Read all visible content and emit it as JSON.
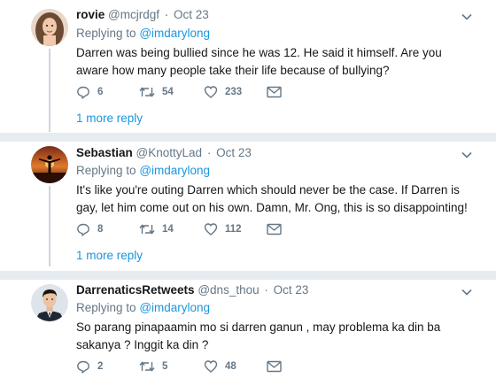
{
  "tweets": [
    {
      "name": "rovie",
      "handle": "@mcjrdgf",
      "time": "Oct 23",
      "replying_prefix": "Replying to",
      "replying_mention": "@imdarylong",
      "text": "Darren was being bullied since he was 12.  He said it himself.  Are you aware how many people take their life because of bullying?",
      "replies": "6",
      "retweets": "54",
      "likes": "233",
      "more_replies": "1 more reply",
      "avatar_icon": "woman-portrait"
    },
    {
      "name": "Sebastian",
      "handle": "@KnottyLad",
      "time": "Oct 23",
      "replying_prefix": "Replying to",
      "replying_mention": "@imdarylong",
      "text": "It's like you're outing Darren which should never be the case. If Darren is gay, let him come out on his own. Damn, Mr. Ong, this is so disappointing!",
      "replies": "8",
      "retweets": "14",
      "likes": "112",
      "more_replies": "1 more reply",
      "avatar_icon": "sunset-silhouette"
    },
    {
      "name": "DarrenaticsRetweets",
      "handle": "@dns_thou",
      "time": "Oct 23",
      "replying_prefix": "Replying to",
      "replying_mention": "@imdarylong",
      "text": "So parang pinapaamin mo si darren ganun , may problema ka din ba sakanya ? Inggit ka din ?",
      "replies": "2",
      "retweets": "5",
      "likes": "48",
      "avatar_icon": "man-in-suit"
    }
  ],
  "colors": {
    "link": "#1b95e0",
    "secondary_text": "#657786",
    "separator": "#e6ecf0",
    "thread_line": "#ccd6dd"
  }
}
